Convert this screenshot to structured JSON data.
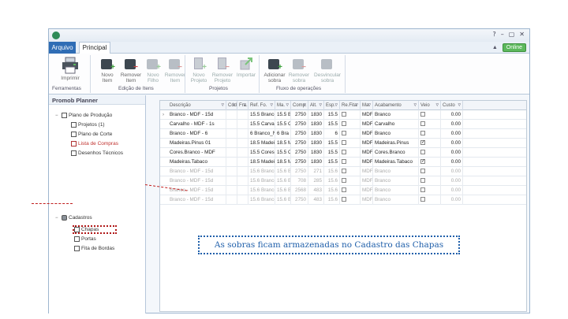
{
  "window": {
    "title": "",
    "controls": [
      "?",
      "–",
      "▢",
      "✕"
    ]
  },
  "menubar": {
    "file_tab": "Arquivo",
    "active_tab": "Principal",
    "status": "Online",
    "collapse_icon": "chevron-up-icon"
  },
  "ribbon": {
    "buttons": [
      {
        "label": "Imprimir",
        "icon": "printer-icon"
      },
      {
        "label": "Novo Item",
        "icon": "add-item-icon"
      },
      {
        "label": "Remover Item",
        "icon": "remove-item-icon"
      },
      {
        "label": "Novo Filho",
        "icon": "add-child-icon"
      },
      {
        "label": "Remover Item",
        "icon": "remove-child-icon"
      },
      {
        "label": "Novo Projeto",
        "icon": "new-project-icon"
      },
      {
        "label": "Remover Projeto",
        "icon": "remove-project-icon"
      },
      {
        "label": "Importar",
        "icon": "import-icon"
      },
      {
        "label": "Adicionar sobra",
        "icon": "add-leftover-icon"
      },
      {
        "label": "Remover sobra",
        "icon": "remove-leftover-icon"
      },
      {
        "label": "Desvincular sobra",
        "icon": "unlink-leftover-icon"
      }
    ],
    "groups": [
      "Ferramentas",
      "Edição de Itens",
      "Projetos",
      "Fluxo de operações"
    ]
  },
  "tree": {
    "title": "Promob Planner",
    "nodes": [
      {
        "label": "Plano de Produção",
        "toggle": "−"
      },
      {
        "label": "Projetos (1)"
      },
      {
        "label": "Plano de Corte"
      },
      {
        "label": "Lista de Compras"
      },
      {
        "label": "Desenhos Técnicos"
      },
      {
        "label": "Cadastros",
        "toggle": "−"
      },
      {
        "label": "Chapas"
      },
      {
        "label": "Portas"
      },
      {
        "label": "Fita de Bordas"
      }
    ]
  },
  "grid": {
    "columns": [
      "Descrição",
      "Cód.",
      "Fra.",
      "Ref. Fo.",
      "Ma.",
      "Comp.",
      "Alt.",
      "Esp.",
      "Re.Fita",
      "Ma.",
      "Acabamento",
      "Veio",
      "Custo"
    ],
    "rows": [
      [
        "Branco - MDF - 15d",
        "",
        "",
        "15.5 Branco",
        "15.5 B",
        "2750",
        "1830",
        "15.5",
        "",
        "MDF",
        "Branco",
        "",
        "0.00"
      ],
      [
        "Carvalho - MDF - 1s",
        "",
        "",
        "15.5 Carva",
        "15.5 C",
        "2750",
        "1830",
        "15.5",
        "",
        "MDF",
        "Carvalho",
        "",
        "0.00"
      ],
      [
        "Branco - MDF - 6",
        "",
        "",
        "6 Branco_N",
        "6 Bra",
        "2750",
        "1830",
        "6",
        "",
        "MDF",
        "Branco",
        "",
        "0.00"
      ],
      [
        "Madeiras.Pinus 01",
        "",
        "",
        "18.5 Madei",
        "18.5 M",
        "2750",
        "1830",
        "15.5",
        "",
        "MDF",
        "Madeiras.Pinus",
        "✓",
        "0.00"
      ],
      [
        "Cores.Branco - MDF",
        "",
        "",
        "15.5 Cores",
        "15.5 C",
        "2750",
        "1830",
        "15.5",
        "",
        "MDF",
        "Cores.Branco",
        "",
        "0.00"
      ],
      [
        "Madeiras.Tabaco",
        "",
        "",
        "18.5 Madei",
        "18.5 M",
        "2750",
        "1830",
        "15.5",
        "",
        "MDF",
        "Madeiras.Tabaco",
        "✓",
        "0.00"
      ],
      [
        "Branco - MDF - 15d",
        "",
        "",
        "15.6 Branco",
        "15.6 B",
        "2750",
        "271",
        "15.6",
        "",
        "MDF",
        "Branco",
        "",
        "0.00"
      ],
      [
        "Branco - MDF - 15d",
        "",
        "",
        "15.6 Branco",
        "15.6 B",
        "708",
        "285",
        "15.6",
        "",
        "MDF",
        "Branco",
        "",
        "0.00"
      ],
      [
        "Branco - MDF - 15d",
        "",
        "",
        "15.6 Branco",
        "15.6 B",
        "2568",
        "483",
        "15.6",
        "",
        "MDF",
        "Branco",
        "",
        "0.00"
      ],
      [
        "Branco - MDF - 15d",
        "",
        "",
        "15.6 Branco",
        "15.6 B",
        "2750",
        "483",
        "15.6",
        "",
        "MDF",
        "Branco",
        "",
        "0.00"
      ]
    ]
  },
  "callout": {
    "text": "As sobras ficam armazenadas no Cadastro das Chapas"
  },
  "colors": {
    "accent": "#2f6db5",
    "annotation_red": "#b01818",
    "callout_blue": "#1f5faa",
    "online_green": "#5cb85c"
  }
}
